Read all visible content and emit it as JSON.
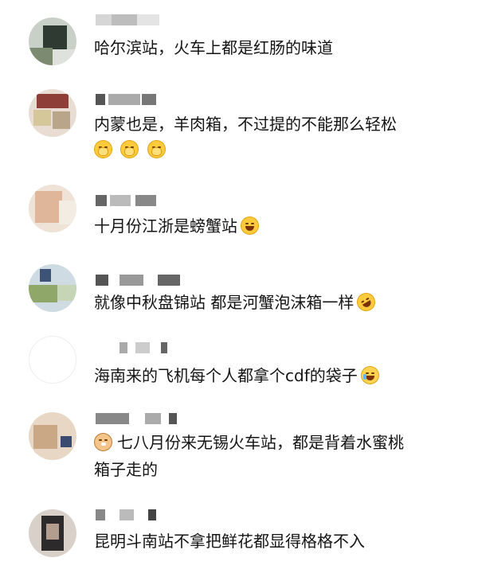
{
  "comments": [
    {
      "text": "哈尔滨站，火车上都是红肠的味道"
    },
    {
      "text": "内蒙也是，羊肉箱，不过提的不能那么轻松",
      "emojis": [
        "shy-face-icon",
        "shy-face-icon",
        "shy-face-icon"
      ]
    },
    {
      "text": "十月份江浙是螃蟹站",
      "emojis": [
        "laughing-tears-icon"
      ]
    },
    {
      "text": "就像中秋盘锦站 都是河蟹泡沫箱一样",
      "emojis": [
        "rolling-laugh-icon"
      ]
    },
    {
      "text": "海南来的飞机每个人都拿个cdf的袋子",
      "emojis": [
        "crying-face-icon"
      ]
    },
    {
      "text_line1": "七八月份来无锡火车站，都是背着水蜜桃",
      "text_line2": "箱子走的",
      "leading_emoji": "cat-face-icon"
    },
    {
      "text": "昆明斗南站不拿把鲜花都显得格格不入"
    }
  ]
}
